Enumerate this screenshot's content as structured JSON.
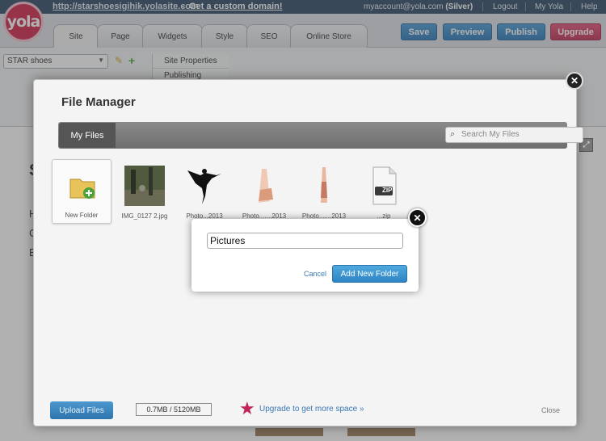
{
  "topbar": {
    "site_url": "http://starshoesigihik.yolasite.com",
    "separator": "-",
    "custom_domain": "Get a custom domain!",
    "account_email": "myaccount@yola.com",
    "account_plan": "(Silver)",
    "logout": "Logout",
    "my_yola": "My Yola",
    "help": "Help"
  },
  "logo": "yola",
  "tabs": [
    "Site",
    "Page",
    "Widgets",
    "Style",
    "SEO",
    "Online Store"
  ],
  "actions": {
    "save": "Save",
    "preview": "Preview",
    "publish": "Publish",
    "upgrade": "Upgrade"
  },
  "page_select": {
    "value": "STAR shoes"
  },
  "site_props": {
    "items": [
      "Site Properties",
      "Publishing"
    ]
  },
  "file_manager": {
    "title": "File Manager",
    "tab": "My Files",
    "search_placeholder": "Search My Files",
    "files": [
      {
        "name": "New Folder",
        "kind": "new-folder"
      },
      {
        "name": "IMG_0127 2.jpg",
        "kind": "photo"
      },
      {
        "name": "Photo...2013",
        "kind": "dancer"
      },
      {
        "name": "Photo.......2013",
        "kind": "shoe"
      },
      {
        "name": "Photo.......2013",
        "kind": "shoe2"
      },
      {
        "name": "...zip",
        "kind": "zip"
      }
    ],
    "zip_label": "ZIP",
    "upload": "Upload Files",
    "usage": "0.7MB / 5120MB",
    "upgrade_link": "Upgrade to get more space »",
    "close": "Close"
  },
  "new_folder_dialog": {
    "input_value": "Pictures",
    "cancel": "Cancel",
    "add": "Add New Folder"
  },
  "bg_letters": [
    "S",
    "H",
    "C",
    "B"
  ]
}
